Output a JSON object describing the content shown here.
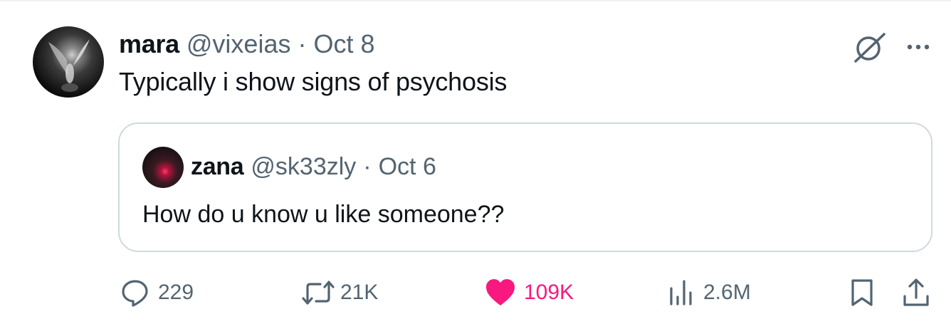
{
  "post": {
    "author_name": "mara",
    "author_handle": "@vixeias",
    "separator": "·",
    "date": "Oct 8",
    "text": "Typically i show signs of psychosis"
  },
  "quoted_post": {
    "author_name": "zana",
    "author_handle": "@sk33zly",
    "separator": "·",
    "date": "Oct 6",
    "text": "How do u know u like someone??"
  },
  "actions": {
    "replies": "229",
    "reposts": "21K",
    "likes": "109K",
    "views": "2.6M"
  },
  "icons": {
    "grok": "grok-icon",
    "more": "more-icon",
    "reply": "reply-icon",
    "repost": "repost-icon",
    "like": "heart-icon",
    "views": "views-icon",
    "bookmark": "bookmark-icon",
    "share": "share-icon"
  },
  "colors": {
    "text": "#0f1419",
    "muted": "#536471",
    "like": "#f91880",
    "border": "#cfd9de"
  }
}
